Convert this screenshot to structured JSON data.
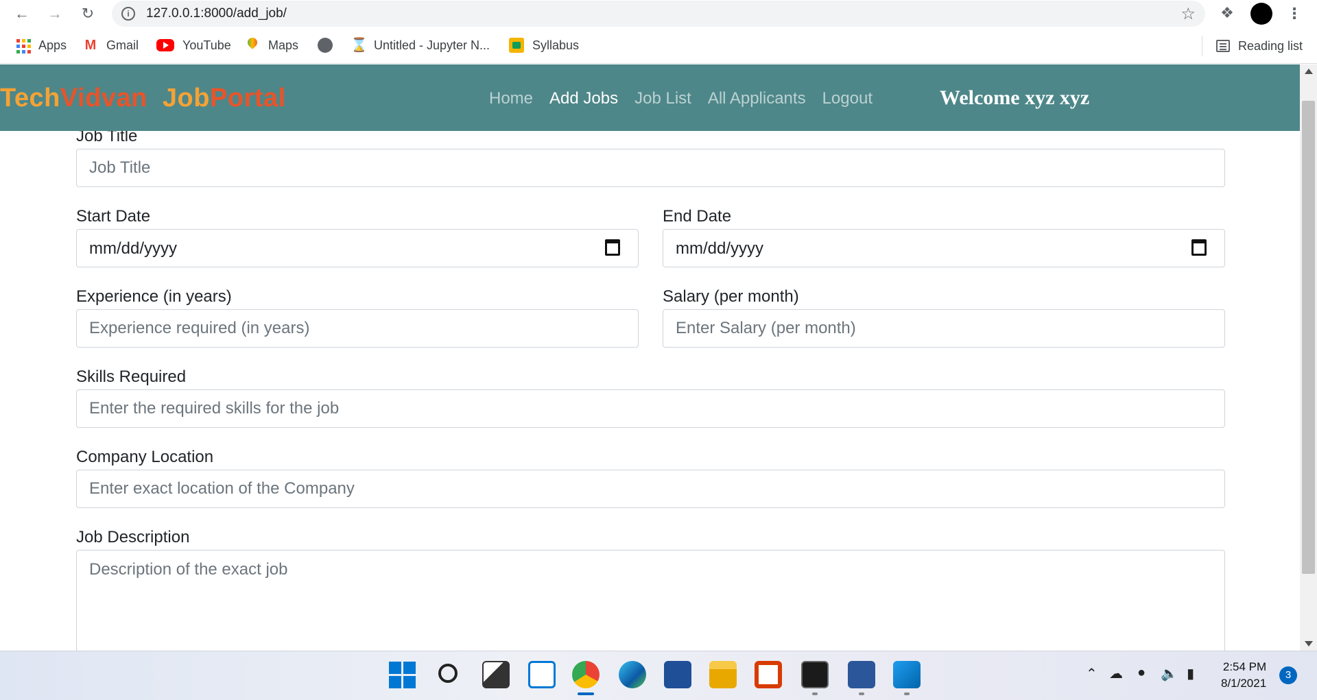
{
  "browser": {
    "url": "127.0.0.1:8000/add_job/",
    "bookmarks": [
      "Apps",
      "Gmail",
      "YouTube",
      "Maps",
      "Untitled - Jupyter N...",
      "Syllabus"
    ],
    "reading_list": "Reading list"
  },
  "navbar": {
    "brand_part1": "Tech",
    "brand_part2": "Vidvan",
    "brand_part3": "Job",
    "brand_part4": "Portal",
    "links": [
      "Home",
      "Add Jobs",
      "Job List",
      "All Applicants",
      "Logout"
    ],
    "active_link": "Add Jobs",
    "welcome": "Welcome xyz xyz"
  },
  "form": {
    "job_title": {
      "label": "Job Title",
      "placeholder": "Job Title"
    },
    "start_date": {
      "label": "Start Date",
      "value": "mm/dd/yyyy"
    },
    "end_date": {
      "label": "End Date",
      "value": "mm/dd/yyyy"
    },
    "experience": {
      "label": "Experience (in years)",
      "placeholder": "Experience required (in years)"
    },
    "salary": {
      "label": "Salary (per month)",
      "placeholder": "Enter Salary (per month)"
    },
    "skills": {
      "label": "Skills Required",
      "placeholder": "Enter the required skills for the job"
    },
    "location": {
      "label": "Company Location",
      "placeholder": "Enter exact location of the Company"
    },
    "description": {
      "label": "Job Description",
      "placeholder": "Description of the exact job"
    }
  },
  "taskbar": {
    "time": "2:54 PM",
    "date": "8/1/2021",
    "notifications": "3"
  }
}
